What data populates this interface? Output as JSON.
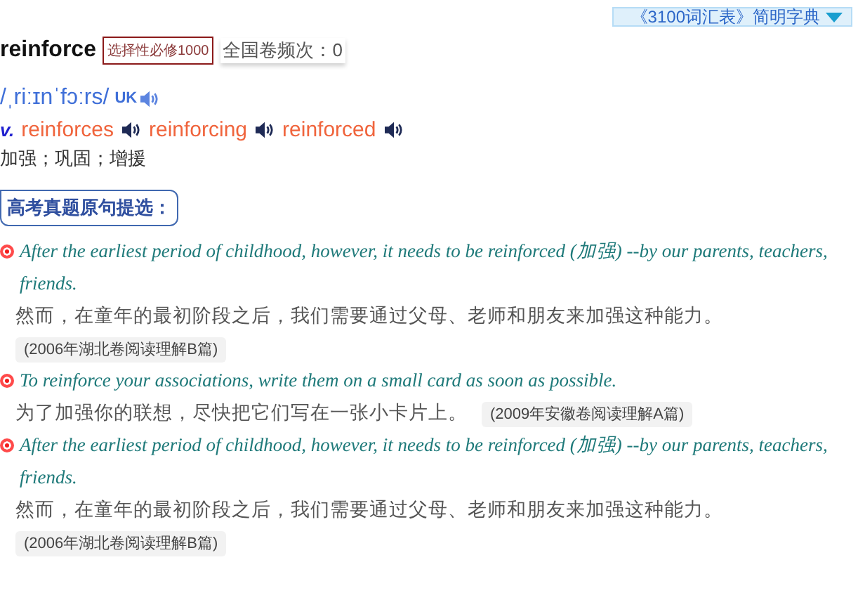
{
  "dictionary_button": {
    "label": "《3100词汇表》简明字典"
  },
  "headword": {
    "word": "reinforce",
    "tag": "选择性必修1000",
    "frequency": "全国卷频次：0"
  },
  "phonetic": {
    "text": "/ˌriːɪnˈfɔːrs/",
    "region": "UK"
  },
  "forms": {
    "pos": "v.",
    "items": [
      "reinforces",
      "reinforcing",
      "reinforced"
    ]
  },
  "meaning": "加强；巩固；增援",
  "section_label": "高考真题原句提选：",
  "examples": [
    {
      "english": "After the earliest period of childhood, however, it needs to be reinforced (加强) --by our parents, teachers, friends.",
      "chinese": "然而，在童年的最初阶段之后，我们需要通过父母、老师和朋友来加强这种能力。",
      "source": "(2006年湖北卷阅读理解B篇)"
    },
    {
      "english": "To reinforce your associations, write them on a small card as soon as possible.",
      "chinese": "为了加强你的联想，尽快把它们写在一张小卡片上。",
      "source": "(2009年安徽卷阅读理解A篇)"
    },
    {
      "english": "After the earliest period of childhood, however, it needs to be reinforced (加强) --by our parents, teachers, friends.",
      "chinese": "然而，在童年的最初阶段之后，我们需要通过父母、老师和朋友来加强这种能力。",
      "source": "(2006年湖北卷阅读理解B篇)"
    }
  ]
}
